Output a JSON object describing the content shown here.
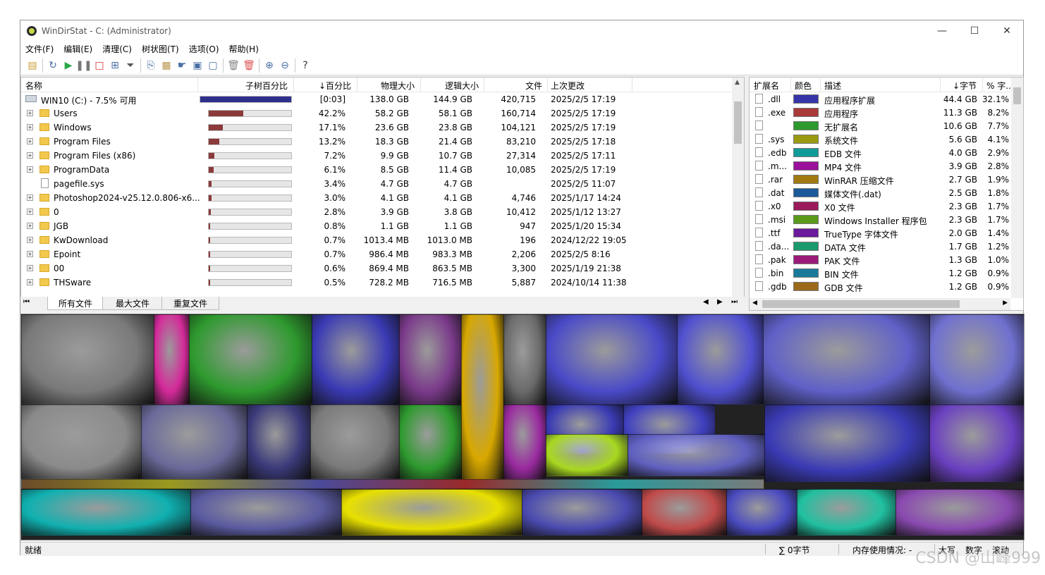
{
  "window": {
    "title": "WinDirStat - C:  (Administrator)"
  },
  "menu": [
    "文件(F)",
    "编辑(E)",
    "清理(C)",
    "树状图(T)",
    "选项(O)",
    "帮助(H)"
  ],
  "dir_columns": [
    "名称",
    "子树百分比",
    "↓百分比",
    "物理大小",
    "逻辑大小",
    "文件",
    "上次更改"
  ],
  "root": {
    "name": "WIN10 (C:) - 7.5% 可用",
    "percent": "[0:03]",
    "physical": "138.0 GB",
    "logical": "144.9 GB",
    "files": "420,715",
    "modified": "2025/2/5  17:19"
  },
  "rows": [
    {
      "name": "Users",
      "bar": 0.422,
      "percent": "42.2%",
      "physical": "58.2 GB",
      "logical": "58.1 GB",
      "files": "160,714",
      "modified": "2025/2/5  17:19",
      "type": "folder"
    },
    {
      "name": "Windows",
      "bar": 0.171,
      "percent": "17.1%",
      "physical": "23.6 GB",
      "logical": "23.8 GB",
      "files": "104,121",
      "modified": "2025/2/5  17:19",
      "type": "folder"
    },
    {
      "name": "Program Files",
      "bar": 0.132,
      "percent": "13.2%",
      "physical": "18.3 GB",
      "logical": "21.4 GB",
      "files": "83,210",
      "modified": "2025/2/5  17:18",
      "type": "folder"
    },
    {
      "name": "Program Files (x86)",
      "bar": 0.072,
      "percent": "7.2%",
      "physical": "9.9 GB",
      "logical": "10.7 GB",
      "files": "27,314",
      "modified": "2025/2/5  17:11",
      "type": "folder"
    },
    {
      "name": "ProgramData",
      "bar": 0.061,
      "percent": "6.1%",
      "physical": "8.5 GB",
      "logical": "11.4 GB",
      "files": "10,085",
      "modified": "2025/2/5  17:19",
      "type": "folder"
    },
    {
      "name": "pagefile.sys",
      "bar": 0.034,
      "percent": "3.4%",
      "physical": "4.7 GB",
      "logical": "4.7 GB",
      "files": "",
      "modified": "2025/2/5  11:07",
      "type": "file"
    },
    {
      "name": "Photoshop2024-v25.12.0.806-x6...",
      "bar": 0.03,
      "percent": "3.0%",
      "physical": "4.1 GB",
      "logical": "4.1 GB",
      "files": "4,746",
      "modified": "2025/1/17  14:24",
      "type": "folder"
    },
    {
      "name": "0",
      "bar": 0.028,
      "percent": "2.8%",
      "physical": "3.9 GB",
      "logical": "3.8 GB",
      "files": "10,412",
      "modified": "2025/1/12  13:27",
      "type": "folder"
    },
    {
      "name": "JGB",
      "bar": 0.008,
      "percent": "0.8%",
      "physical": "1.1 GB",
      "logical": "1.1 GB",
      "files": "947",
      "modified": "2025/1/20  15:34",
      "type": "folder"
    },
    {
      "name": "KwDownload",
      "bar": 0.007,
      "percent": "0.7%",
      "physical": "1013.4 MB",
      "logical": "1013.0 MB",
      "files": "196",
      "modified": "2024/12/22  19:05",
      "type": "folder"
    },
    {
      "name": "Epoint",
      "bar": 0.007,
      "percent": "0.7%",
      "physical": "986.4 MB",
      "logical": "983.3 MB",
      "files": "2,206",
      "modified": "2025/2/5  8:16",
      "type": "folder"
    },
    {
      "name": "00",
      "bar": 0.006,
      "percent": "0.6%",
      "physical": "869.4 MB",
      "logical": "863.5 MB",
      "files": "3,300",
      "modified": "2025/1/19  21:38",
      "type": "folder"
    },
    {
      "name": "THSware",
      "bar": 0.005,
      "percent": "0.5%",
      "physical": "728.2 MB",
      "logical": "716.5 MB",
      "files": "5,887",
      "modified": "2024/10/14  11:38",
      "type": "folder"
    }
  ],
  "tabs": [
    "所有文件",
    "最大文件",
    "重复文件"
  ],
  "ext_columns": [
    "扩展名",
    "颜色",
    "描述",
    "↓字节",
    "% 字..."
  ],
  "extensions": [
    {
      "ext": ".dll",
      "color": "#3535a8",
      "desc": "应用程序扩展",
      "bytes": "44.4 GB",
      "pct": "32.1%"
    },
    {
      "ext": ".exe",
      "color": "#a83a3a",
      "desc": "应用程序",
      "bytes": "11.3 GB",
      "pct": "8.2%"
    },
    {
      "ext": "",
      "color": "#2e9a2e",
      "desc": "无扩展名",
      "bytes": "10.6 GB",
      "pct": "7.7%"
    },
    {
      "ext": ".sys",
      "color": "#9a9a10",
      "desc": "系统文件",
      "bytes": "5.6 GB",
      "pct": "4.1%"
    },
    {
      "ext": ".edb",
      "color": "#109a9a",
      "desc": "EDB 文件",
      "bytes": "4.0 GB",
      "pct": "2.9%"
    },
    {
      "ext": ".m...",
      "color": "#9a109a",
      "desc": "MP4 文件",
      "bytes": "3.9 GB",
      "pct": "2.8%"
    },
    {
      "ext": ".rar",
      "color": "#a07a10",
      "desc": "WinRAR 压缩文件",
      "bytes": "2.7 GB",
      "pct": "1.9%"
    },
    {
      "ext": ".dat",
      "color": "#1a5a9a",
      "desc": "媒体文件(.dat)",
      "bytes": "2.5 GB",
      "pct": "1.8%"
    },
    {
      "ext": ".x0",
      "color": "#9a1a5a",
      "desc": "X0 文件",
      "bytes": "2.3 GB",
      "pct": "1.7%"
    },
    {
      "ext": ".msi",
      "color": "#5a9a1a",
      "desc": "Windows Installer 程序包",
      "bytes": "2.3 GB",
      "pct": "1.7%"
    },
    {
      "ext": ".ttf",
      "color": "#6a1a9a",
      "desc": "TrueType 字体文件",
      "bytes": "2.0 GB",
      "pct": "1.4%"
    },
    {
      "ext": ".da...",
      "color": "#1a9a6a",
      "desc": "DATA 文件",
      "bytes": "1.7 GB",
      "pct": "1.2%"
    },
    {
      "ext": ".pak",
      "color": "#9a1a7a",
      "desc": "PAK 文件",
      "bytes": "1.3 GB",
      "pct": "1.0%"
    },
    {
      "ext": ".bin",
      "color": "#1a7a9a",
      "desc": "BIN 文件",
      "bytes": "1.2 GB",
      "pct": "0.9%"
    },
    {
      "ext": ".gdb",
      "color": "#9a6a1a",
      "desc": "GDB 文件",
      "bytes": "1.2 GB",
      "pct": "0.9%"
    }
  ],
  "status": {
    "ready": "就绪",
    "bytes": "∑ 0字节",
    "memory": "内存使用情况: -",
    "caps": "大写",
    "num": "数字",
    "scroll": "滚动"
  },
  "watermark": "CSDN @山峰999"
}
